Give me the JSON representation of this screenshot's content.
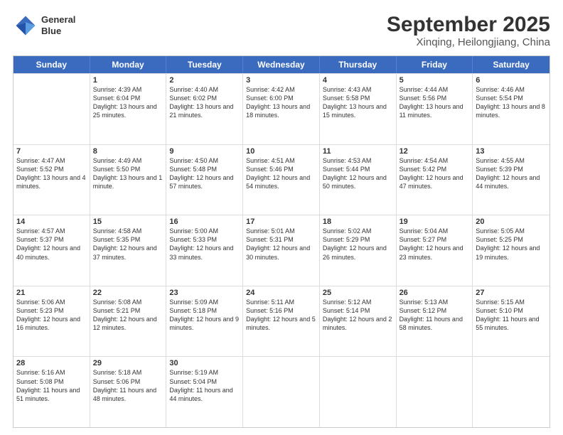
{
  "header": {
    "logo_line1": "General",
    "logo_line2": "Blue",
    "title": "September 2025",
    "subtitle": "Xinqing, Heilongjiang, China"
  },
  "calendar": {
    "days_of_week": [
      "Sunday",
      "Monday",
      "Tuesday",
      "Wednesday",
      "Thursday",
      "Friday",
      "Saturday"
    ],
    "weeks": [
      [
        {
          "day": "",
          "sunrise": "",
          "sunset": "",
          "daylight": ""
        },
        {
          "day": "1",
          "sunrise": "Sunrise: 4:39 AM",
          "sunset": "Sunset: 6:04 PM",
          "daylight": "Daylight: 13 hours and 25 minutes."
        },
        {
          "day": "2",
          "sunrise": "Sunrise: 4:40 AM",
          "sunset": "Sunset: 6:02 PM",
          "daylight": "Daylight: 13 hours and 21 minutes."
        },
        {
          "day": "3",
          "sunrise": "Sunrise: 4:42 AM",
          "sunset": "Sunset: 6:00 PM",
          "daylight": "Daylight: 13 hours and 18 minutes."
        },
        {
          "day": "4",
          "sunrise": "Sunrise: 4:43 AM",
          "sunset": "Sunset: 5:58 PM",
          "daylight": "Daylight: 13 hours and 15 minutes."
        },
        {
          "day": "5",
          "sunrise": "Sunrise: 4:44 AM",
          "sunset": "Sunset: 5:56 PM",
          "daylight": "Daylight: 13 hours and 11 minutes."
        },
        {
          "day": "6",
          "sunrise": "Sunrise: 4:46 AM",
          "sunset": "Sunset: 5:54 PM",
          "daylight": "Daylight: 13 hours and 8 minutes."
        }
      ],
      [
        {
          "day": "7",
          "sunrise": "Sunrise: 4:47 AM",
          "sunset": "Sunset: 5:52 PM",
          "daylight": "Daylight: 13 hours and 4 minutes."
        },
        {
          "day": "8",
          "sunrise": "Sunrise: 4:49 AM",
          "sunset": "Sunset: 5:50 PM",
          "daylight": "Daylight: 13 hours and 1 minute."
        },
        {
          "day": "9",
          "sunrise": "Sunrise: 4:50 AM",
          "sunset": "Sunset: 5:48 PM",
          "daylight": "Daylight: 12 hours and 57 minutes."
        },
        {
          "day": "10",
          "sunrise": "Sunrise: 4:51 AM",
          "sunset": "Sunset: 5:46 PM",
          "daylight": "Daylight: 12 hours and 54 minutes."
        },
        {
          "day": "11",
          "sunrise": "Sunrise: 4:53 AM",
          "sunset": "Sunset: 5:44 PM",
          "daylight": "Daylight: 12 hours and 50 minutes."
        },
        {
          "day": "12",
          "sunrise": "Sunrise: 4:54 AM",
          "sunset": "Sunset: 5:42 PM",
          "daylight": "Daylight: 12 hours and 47 minutes."
        },
        {
          "day": "13",
          "sunrise": "Sunrise: 4:55 AM",
          "sunset": "Sunset: 5:39 PM",
          "daylight": "Daylight: 12 hours and 44 minutes."
        }
      ],
      [
        {
          "day": "14",
          "sunrise": "Sunrise: 4:57 AM",
          "sunset": "Sunset: 5:37 PM",
          "daylight": "Daylight: 12 hours and 40 minutes."
        },
        {
          "day": "15",
          "sunrise": "Sunrise: 4:58 AM",
          "sunset": "Sunset: 5:35 PM",
          "daylight": "Daylight: 12 hours and 37 minutes."
        },
        {
          "day": "16",
          "sunrise": "Sunrise: 5:00 AM",
          "sunset": "Sunset: 5:33 PM",
          "daylight": "Daylight: 12 hours and 33 minutes."
        },
        {
          "day": "17",
          "sunrise": "Sunrise: 5:01 AM",
          "sunset": "Sunset: 5:31 PM",
          "daylight": "Daylight: 12 hours and 30 minutes."
        },
        {
          "day": "18",
          "sunrise": "Sunrise: 5:02 AM",
          "sunset": "Sunset: 5:29 PM",
          "daylight": "Daylight: 12 hours and 26 minutes."
        },
        {
          "day": "19",
          "sunrise": "Sunrise: 5:04 AM",
          "sunset": "Sunset: 5:27 PM",
          "daylight": "Daylight: 12 hours and 23 minutes."
        },
        {
          "day": "20",
          "sunrise": "Sunrise: 5:05 AM",
          "sunset": "Sunset: 5:25 PM",
          "daylight": "Daylight: 12 hours and 19 minutes."
        }
      ],
      [
        {
          "day": "21",
          "sunrise": "Sunrise: 5:06 AM",
          "sunset": "Sunset: 5:23 PM",
          "daylight": "Daylight: 12 hours and 16 minutes."
        },
        {
          "day": "22",
          "sunrise": "Sunrise: 5:08 AM",
          "sunset": "Sunset: 5:21 PM",
          "daylight": "Daylight: 12 hours and 12 minutes."
        },
        {
          "day": "23",
          "sunrise": "Sunrise: 5:09 AM",
          "sunset": "Sunset: 5:18 PM",
          "daylight": "Daylight: 12 hours and 9 minutes."
        },
        {
          "day": "24",
          "sunrise": "Sunrise: 5:11 AM",
          "sunset": "Sunset: 5:16 PM",
          "daylight": "Daylight: 12 hours and 5 minutes."
        },
        {
          "day": "25",
          "sunrise": "Sunrise: 5:12 AM",
          "sunset": "Sunset: 5:14 PM",
          "daylight": "Daylight: 12 hours and 2 minutes."
        },
        {
          "day": "26",
          "sunrise": "Sunrise: 5:13 AM",
          "sunset": "Sunset: 5:12 PM",
          "daylight": "Daylight: 11 hours and 58 minutes."
        },
        {
          "day": "27",
          "sunrise": "Sunrise: 5:15 AM",
          "sunset": "Sunset: 5:10 PM",
          "daylight": "Daylight: 11 hours and 55 minutes."
        }
      ],
      [
        {
          "day": "28",
          "sunrise": "Sunrise: 5:16 AM",
          "sunset": "Sunset: 5:08 PM",
          "daylight": "Daylight: 11 hours and 51 minutes."
        },
        {
          "day": "29",
          "sunrise": "Sunrise: 5:18 AM",
          "sunset": "Sunset: 5:06 PM",
          "daylight": "Daylight: 11 hours and 48 minutes."
        },
        {
          "day": "30",
          "sunrise": "Sunrise: 5:19 AM",
          "sunset": "Sunset: 5:04 PM",
          "daylight": "Daylight: 11 hours and 44 minutes."
        },
        {
          "day": "",
          "sunrise": "",
          "sunset": "",
          "daylight": ""
        },
        {
          "day": "",
          "sunrise": "",
          "sunset": "",
          "daylight": ""
        },
        {
          "day": "",
          "sunrise": "",
          "sunset": "",
          "daylight": ""
        },
        {
          "day": "",
          "sunrise": "",
          "sunset": "",
          "daylight": ""
        }
      ]
    ]
  }
}
